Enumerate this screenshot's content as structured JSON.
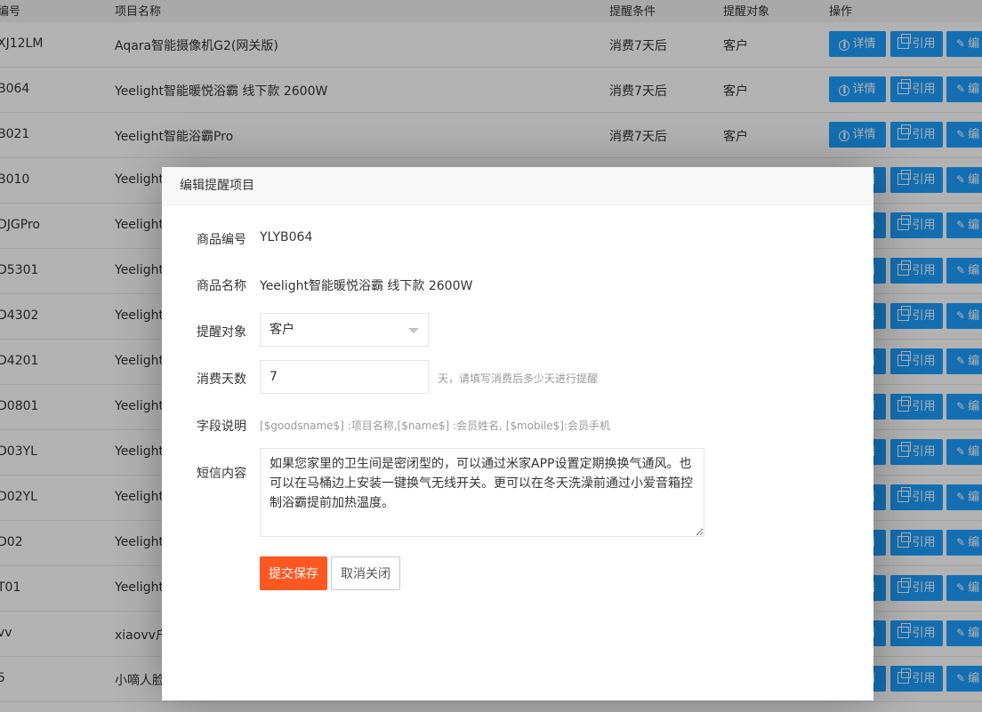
{
  "table": {
    "headers": {
      "id": "编号",
      "name": "项目名称",
      "condition": "提醒条件",
      "target": "提醒对象",
      "ops": "操作"
    },
    "rows": [
      {
        "id": "XJ12LM",
        "name": "Aqara智能摄像机G2(网关版)",
        "condition": "消费7天后",
        "target": "客户"
      },
      {
        "id": "B064",
        "name": "Yeelight智能暖悦浴霸 线下款 2600W",
        "condition": "消费7天后",
        "target": "客户"
      },
      {
        "id": "B021",
        "name": "Yeelight智能浴霸Pro",
        "condition": "消费7天后",
        "target": "客户"
      },
      {
        "id": "B010",
        "name": "Yeelight",
        "condition": "",
        "target": ""
      },
      {
        "id": "DJGPro",
        "name": "Yeelight",
        "condition": "",
        "target": ""
      },
      {
        "id": "D5301",
        "name": "Yeelight",
        "condition": "",
        "target": ""
      },
      {
        "id": "D4302",
        "name": "Yeelight",
        "condition": "",
        "target": ""
      },
      {
        "id": "D4201",
        "name": "Yeelight",
        "condition": "",
        "target": ""
      },
      {
        "id": "D0801",
        "name": "Yeelight",
        "condition": "",
        "target": ""
      },
      {
        "id": "D03YL",
        "name": "Yeelight",
        "condition": "",
        "target": ""
      },
      {
        "id": "D02YL",
        "name": "Yeelight",
        "condition": "",
        "target": ""
      },
      {
        "id": "D02",
        "name": "Yeelight",
        "condition": "",
        "target": ""
      },
      {
        "id": "T01",
        "name": "Yeelight",
        "condition": "",
        "target": ""
      },
      {
        "id": "vv",
        "name": "xiaovv户",
        "condition": "",
        "target": ""
      },
      {
        "id": "5",
        "name": "小嘀人脸",
        "condition": "",
        "target": ""
      }
    ],
    "actions": {
      "detail": "详情",
      "cite": "引用",
      "edit": "编"
    }
  },
  "modal": {
    "title": "编辑提醒项目",
    "fields": {
      "code_label": "商品编号",
      "code_value": "YLYB064",
      "name_label": "商品名称",
      "name_value": "Yeelight智能暖悦浴霸 线下款 2600W",
      "target_label": "提醒对象",
      "target_value": "客户",
      "days_label": "消费天数",
      "days_value": "7",
      "days_hint": "天，请填写消费后多少天进行提醒",
      "fields_label": "字段说明",
      "fields_note": "[$goodsname$] :项目名称,[$name$] :会员姓名, [$mobile$]:会员手机",
      "sms_label": "短信内容",
      "sms_value": "如果您家里的卫生间是密闭型的，可以通过米家APP设置定期换换气通风。也可以在马桶边上安装一键换气无线开关。更可以在冬天洗澡前通过小爱音箱控制浴霸提前加热温度。"
    },
    "buttons": {
      "save": "提交保存",
      "cancel": "取消关闭"
    }
  },
  "colors": {
    "primary": "#1e9fff",
    "danger": "#ff5722",
    "overlay": "rgba(0,0,0,0.3)"
  }
}
